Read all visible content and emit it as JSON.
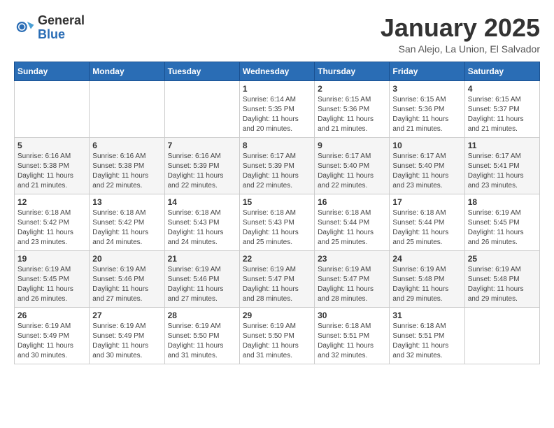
{
  "logo": {
    "general": "General",
    "blue": "Blue"
  },
  "calendar": {
    "title": "January 2025",
    "subtitle": "San Alejo, La Union, El Salvador",
    "weekdays": [
      "Sunday",
      "Monday",
      "Tuesday",
      "Wednesday",
      "Thursday",
      "Friday",
      "Saturday"
    ],
    "weeks": [
      [
        {
          "day": "",
          "sunrise": "",
          "sunset": "",
          "daylight": ""
        },
        {
          "day": "",
          "sunrise": "",
          "sunset": "",
          "daylight": ""
        },
        {
          "day": "",
          "sunrise": "",
          "sunset": "",
          "daylight": ""
        },
        {
          "day": "1",
          "sunrise": "6:14 AM",
          "sunset": "5:35 PM",
          "daylight": "11 hours and 20 minutes."
        },
        {
          "day": "2",
          "sunrise": "6:15 AM",
          "sunset": "5:36 PM",
          "daylight": "11 hours and 21 minutes."
        },
        {
          "day": "3",
          "sunrise": "6:15 AM",
          "sunset": "5:36 PM",
          "daylight": "11 hours and 21 minutes."
        },
        {
          "day": "4",
          "sunrise": "6:15 AM",
          "sunset": "5:37 PM",
          "daylight": "11 hours and 21 minutes."
        }
      ],
      [
        {
          "day": "5",
          "sunrise": "6:16 AM",
          "sunset": "5:38 PM",
          "daylight": "11 hours and 21 minutes."
        },
        {
          "day": "6",
          "sunrise": "6:16 AM",
          "sunset": "5:38 PM",
          "daylight": "11 hours and 22 minutes."
        },
        {
          "day": "7",
          "sunrise": "6:16 AM",
          "sunset": "5:39 PM",
          "daylight": "11 hours and 22 minutes."
        },
        {
          "day": "8",
          "sunrise": "6:17 AM",
          "sunset": "5:39 PM",
          "daylight": "11 hours and 22 minutes."
        },
        {
          "day": "9",
          "sunrise": "6:17 AM",
          "sunset": "5:40 PM",
          "daylight": "11 hours and 22 minutes."
        },
        {
          "day": "10",
          "sunrise": "6:17 AM",
          "sunset": "5:40 PM",
          "daylight": "11 hours and 23 minutes."
        },
        {
          "day": "11",
          "sunrise": "6:17 AM",
          "sunset": "5:41 PM",
          "daylight": "11 hours and 23 minutes."
        }
      ],
      [
        {
          "day": "12",
          "sunrise": "6:18 AM",
          "sunset": "5:42 PM",
          "daylight": "11 hours and 23 minutes."
        },
        {
          "day": "13",
          "sunrise": "6:18 AM",
          "sunset": "5:42 PM",
          "daylight": "11 hours and 24 minutes."
        },
        {
          "day": "14",
          "sunrise": "6:18 AM",
          "sunset": "5:43 PM",
          "daylight": "11 hours and 24 minutes."
        },
        {
          "day": "15",
          "sunrise": "6:18 AM",
          "sunset": "5:43 PM",
          "daylight": "11 hours and 25 minutes."
        },
        {
          "day": "16",
          "sunrise": "6:18 AM",
          "sunset": "5:44 PM",
          "daylight": "11 hours and 25 minutes."
        },
        {
          "day": "17",
          "sunrise": "6:18 AM",
          "sunset": "5:44 PM",
          "daylight": "11 hours and 25 minutes."
        },
        {
          "day": "18",
          "sunrise": "6:19 AM",
          "sunset": "5:45 PM",
          "daylight": "11 hours and 26 minutes."
        }
      ],
      [
        {
          "day": "19",
          "sunrise": "6:19 AM",
          "sunset": "5:45 PM",
          "daylight": "11 hours and 26 minutes."
        },
        {
          "day": "20",
          "sunrise": "6:19 AM",
          "sunset": "5:46 PM",
          "daylight": "11 hours and 27 minutes."
        },
        {
          "day": "21",
          "sunrise": "6:19 AM",
          "sunset": "5:46 PM",
          "daylight": "11 hours and 27 minutes."
        },
        {
          "day": "22",
          "sunrise": "6:19 AM",
          "sunset": "5:47 PM",
          "daylight": "11 hours and 28 minutes."
        },
        {
          "day": "23",
          "sunrise": "6:19 AM",
          "sunset": "5:47 PM",
          "daylight": "11 hours and 28 minutes."
        },
        {
          "day": "24",
          "sunrise": "6:19 AM",
          "sunset": "5:48 PM",
          "daylight": "11 hours and 29 minutes."
        },
        {
          "day": "25",
          "sunrise": "6:19 AM",
          "sunset": "5:48 PM",
          "daylight": "11 hours and 29 minutes."
        }
      ],
      [
        {
          "day": "26",
          "sunrise": "6:19 AM",
          "sunset": "5:49 PM",
          "daylight": "11 hours and 30 minutes."
        },
        {
          "day": "27",
          "sunrise": "6:19 AM",
          "sunset": "5:49 PM",
          "daylight": "11 hours and 30 minutes."
        },
        {
          "day": "28",
          "sunrise": "6:19 AM",
          "sunset": "5:50 PM",
          "daylight": "11 hours and 31 minutes."
        },
        {
          "day": "29",
          "sunrise": "6:19 AM",
          "sunset": "5:50 PM",
          "daylight": "11 hours and 31 minutes."
        },
        {
          "day": "30",
          "sunrise": "6:18 AM",
          "sunset": "5:51 PM",
          "daylight": "11 hours and 32 minutes."
        },
        {
          "day": "31",
          "sunrise": "6:18 AM",
          "sunset": "5:51 PM",
          "daylight": "11 hours and 32 minutes."
        },
        {
          "day": "",
          "sunrise": "",
          "sunset": "",
          "daylight": ""
        }
      ]
    ],
    "labels": {
      "sunrise": "Sunrise:",
      "sunset": "Sunset:",
      "daylight": "Daylight:"
    }
  }
}
